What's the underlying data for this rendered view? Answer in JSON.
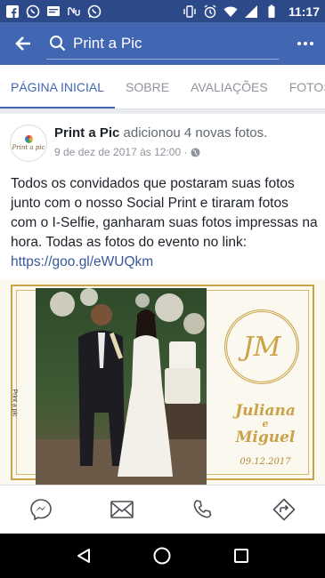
{
  "status_bar": {
    "time": "11:17",
    "left_icons": [
      "facebook-icon",
      "whatsapp-icon",
      "message-icon",
      "nu-icon",
      "whatsapp-icon"
    ],
    "right_icons": [
      "vibrate-icon",
      "alarm-icon",
      "wifi-icon",
      "signal-icon",
      "battery-icon"
    ]
  },
  "app_bar": {
    "search_text": "Print a Pic"
  },
  "tabs": [
    {
      "label": "PÁGINA INICIAL",
      "active": true
    },
    {
      "label": "SOBRE",
      "active": false
    },
    {
      "label": "AVALIAÇÕES",
      "active": false
    },
    {
      "label": "FOTOS",
      "active": false
    }
  ],
  "post": {
    "avatar_text": "Print a pic",
    "page_name": "Print a Pic",
    "action": "adicionou 4 novas fotos.",
    "timestamp": "9 de dez de 2017 às 12:00 ·",
    "body": "Todos os convidados que postaram suas fotos junto com o nosso Social Print e tiraram fotos com o I-Selfie, ganharam suas fotos impressas na hora. Todas as fotos do evento no link:",
    "link": "https://goo.gl/eWUQkm",
    "photo": {
      "monogram": "JM",
      "names_line1": "Juliana",
      "names_amp": "e",
      "names_line2": "Miguel",
      "date": "09.12.2017",
      "side_brand": "Print a pic"
    }
  },
  "actions": [
    "messenger-icon",
    "mail-icon",
    "phone-icon",
    "directions-icon"
  ],
  "colors": {
    "status_bar": "#2c4a8a",
    "app_bar": "#4267b2",
    "link": "#365899",
    "gold": "#c9a24a"
  }
}
